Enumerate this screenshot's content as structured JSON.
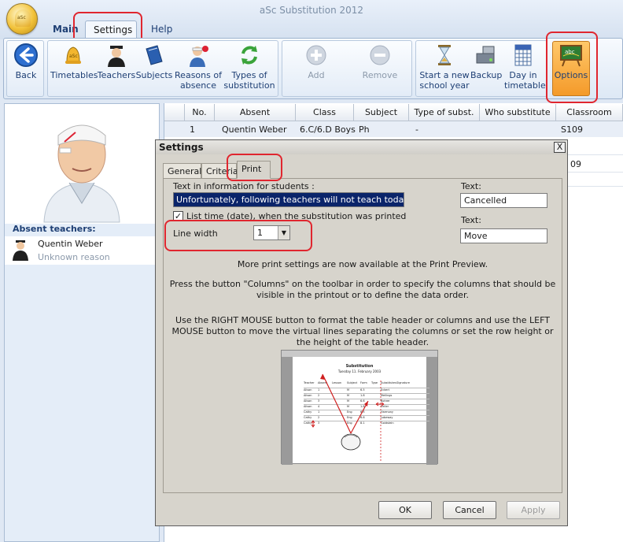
{
  "app": {
    "title": "aSc Substitution 2012",
    "logo_text": "aSc"
  },
  "ribbon_tabs": [
    {
      "label": "Main"
    },
    {
      "label": "Settings"
    },
    {
      "label": "Help"
    }
  ],
  "ribbon": {
    "back": "Back",
    "timetables": "Timetables",
    "teachers": "Teachers",
    "subjects": "Subjects",
    "reasons_line1": "Reasons of",
    "reasons_line2": "absence",
    "types_line1": "Types of",
    "types_line2": "substitution",
    "add": "Add",
    "remove": "Remove",
    "new_year_line1": "Start a new",
    "new_year_line2": "school year",
    "backup": "Backup",
    "day_line1": "Day in",
    "day_line2": "timetable",
    "options": "Options",
    "options_board_text": "abc"
  },
  "left_panel": {
    "absent_title": "Absent teachers:",
    "teacher_name": "Quentin Weber",
    "teacher_reason": "Unknown reason"
  },
  "grid": {
    "headers": [
      "No.",
      "Absent",
      "Class",
      "Subject",
      "Type of subst.",
      "Who substitute",
      "Classroom"
    ],
    "row1": {
      "no": "1",
      "absent": "Quentin Weber",
      "class": "6.C/6.D Boys",
      "subject": "Ph",
      "type": "-",
      "who": "",
      "classroom": "S109"
    },
    "row3_classroom_fragment": "09"
  },
  "dialog": {
    "title": "Settings",
    "close": "X",
    "tabs": [
      {
        "label": "General"
      },
      {
        "label": "Criteria"
      },
      {
        "label": "Print"
      }
    ],
    "text_info_label": "Text in information for students :",
    "text_info_value": "Unfortunately, following teachers will not teach today:",
    "list_time_label": "List time (date), when the substitution was printed",
    "list_time_checked": true,
    "line_width_label": "Line width",
    "line_width_value": "1",
    "text1_label": "Text:",
    "text1_value": "Cancelled",
    "text2_label": "Text:",
    "text2_value": "Move",
    "note1": "More print settings are now available at the Print Preview.",
    "note2": "Press the button \"Columns\" on the toolbar in order to specify the columns that should be visible in the printout or to define the data order.",
    "note3": "Use the RIGHT MOUSE button to format the table header or columns and use the LEFT MOUSE button to move the virtual lines separating the columns or set the row height or the height of the table header.",
    "preview": {
      "title": "Substitution",
      "subtitle": "Tuesday 11. February 2003",
      "headers": [
        "Teacher",
        "Absent",
        "Lesson",
        "Subject",
        "Form",
        "Type",
        "Substitutes",
        "Signature"
      ],
      "rows": [
        [
          "Alison",
          "1",
          "M",
          "6.5",
          "Eckert"
        ],
        [
          "Alison",
          "2",
          "M",
          "1.8",
          "Mellings"
        ],
        [
          "Alison",
          "3",
          "M",
          "6.6",
          "Bohrer"
        ],
        [
          "Alison",
          "4",
          "M",
          "1.8",
          "Zeller"
        ],
        [
          "Cathy",
          "1",
          "Eng",
          "6.5",
          "Harmony"
        ],
        [
          "Cathy",
          "2",
          "Eng",
          "6.6",
          "Lobeway"
        ],
        [
          "Cathy",
          "3",
          "Eng",
          "8.1",
          "Goldstein"
        ]
      ]
    },
    "ok": "OK",
    "cancel": "Cancel",
    "apply": "Apply"
  },
  "colors": {
    "highlight": "#e0262f",
    "ribbon_text": "#1e3f74",
    "options_bg": "#f7a43a"
  }
}
